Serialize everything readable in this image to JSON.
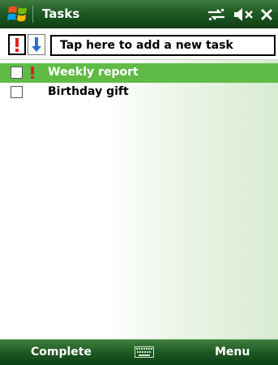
{
  "titlebar": {
    "title": "Tasks",
    "icons": [
      "windows-start-icon",
      "connectivity-icon",
      "speaker-muted-icon",
      "close-icon"
    ]
  },
  "toolbar": {
    "priority_icon": "red-exclamation-icon",
    "sort_icon": "blue-arrow-down-icon",
    "add_task_text": "Tap here to add a new task"
  },
  "tasks": [
    {
      "label": "Weekly report",
      "high_priority": true,
      "selected": true,
      "completed": false
    },
    {
      "label": "Birthday gift",
      "high_priority": false,
      "selected": false,
      "completed": false
    }
  ],
  "softkeys": {
    "left": "Complete",
    "center_icon": "keyboard-icon",
    "right": "Menu"
  },
  "colors": {
    "titlebar": "#1f5a24",
    "selection": "#5fbb46",
    "priority": "#e02020",
    "sort_arrow": "#2a6fd0"
  }
}
